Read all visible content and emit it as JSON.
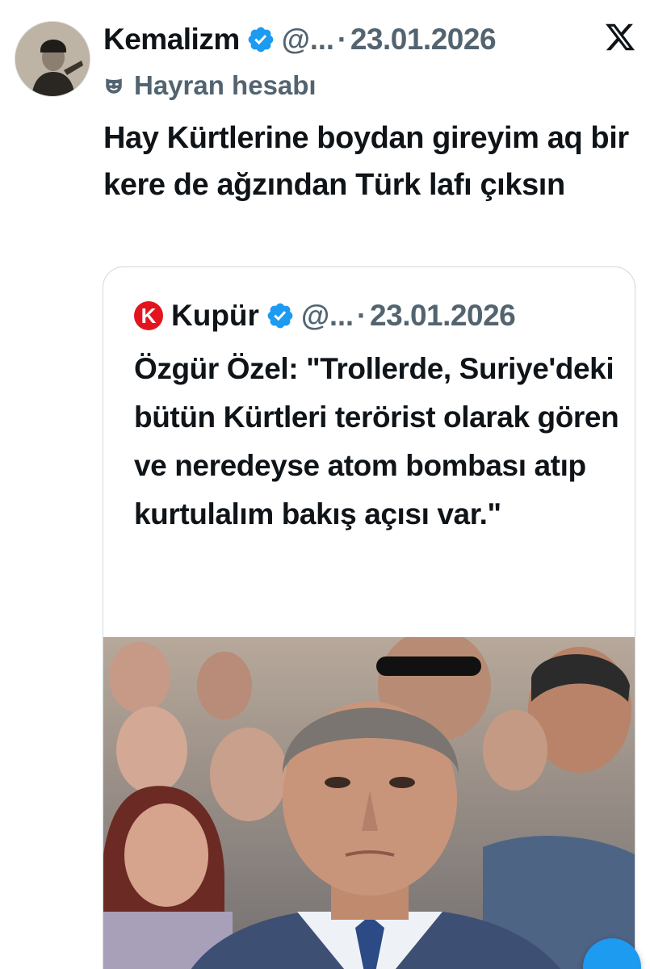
{
  "tweet": {
    "author_name": "Kemalizm",
    "handle": "@...",
    "separator": "·",
    "date": "23.01.2026",
    "fan_account_label": "Hayran hesabı",
    "text": "Hay Kürtlerine boydan gireyim aq bir kere de ağzından Türk lafı çıksın",
    "icons": {
      "verified": "verified-badge-icon",
      "platform": "x-logo-icon",
      "fan": "mask-icon"
    }
  },
  "quoted_tweet": {
    "logo_letter": "K",
    "author_name": "Kupür",
    "handle": "@...",
    "separator": "·",
    "date": "23.01.2026",
    "text": "Özgür Özel: \"Trollerde, Suriye'deki bütün Kürtleri terörist olarak gören ve neredeyse atom bombası atıp kurtulalım bakış açısı var.\""
  },
  "colors": {
    "verified_blue": "#1d9bf0",
    "secondary_text": "#536471",
    "brand_red": "#e3141e"
  }
}
